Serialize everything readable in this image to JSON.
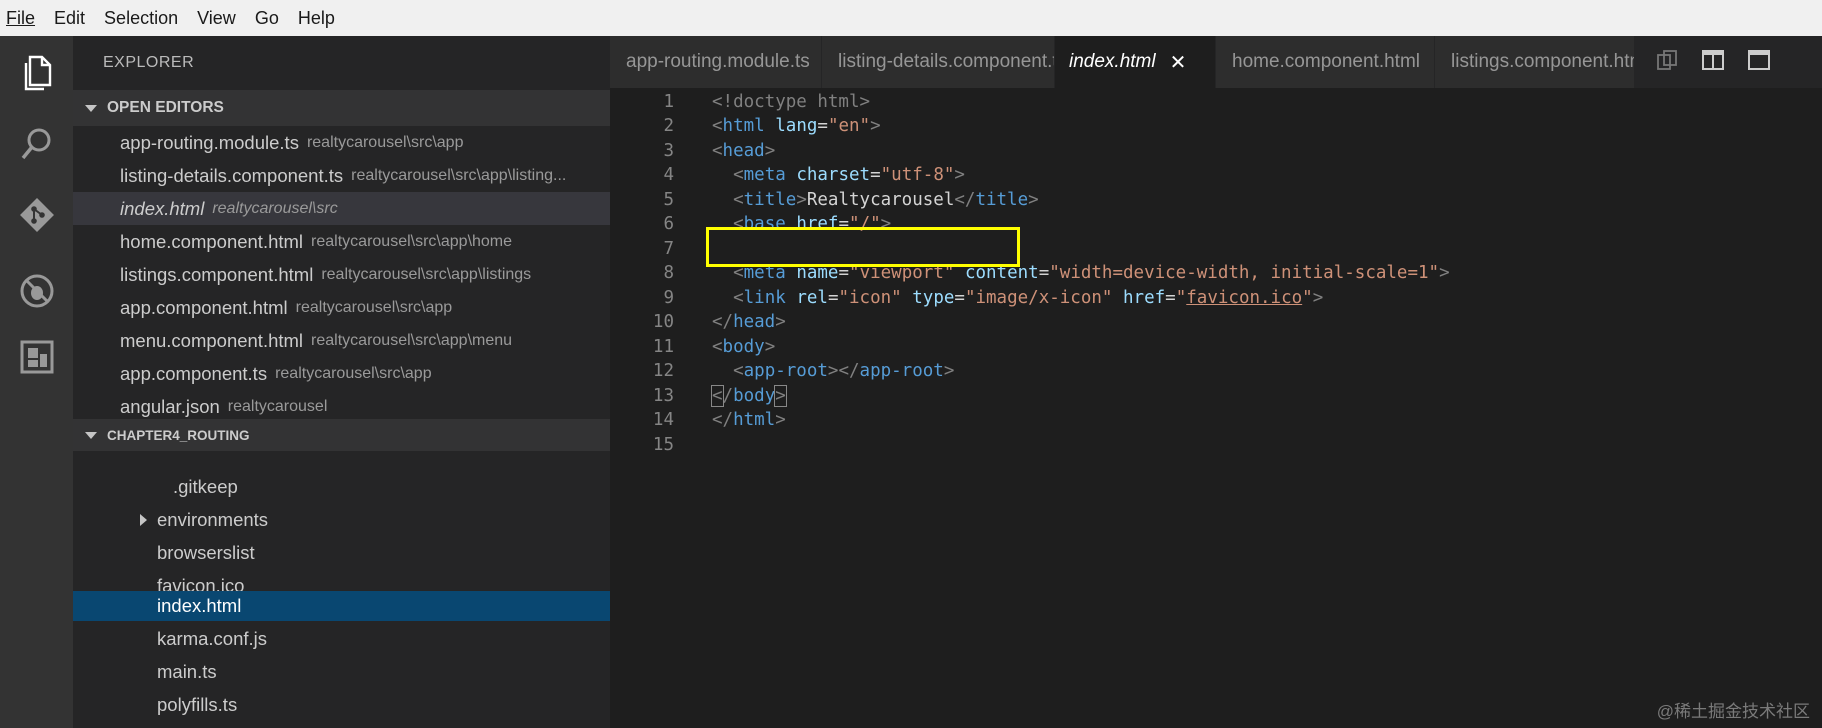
{
  "menu": [
    "File",
    "Edit",
    "Selection",
    "View",
    "Go",
    "Help"
  ],
  "activity": [
    "files-icon",
    "search-icon",
    "source-control-icon",
    "debug-icon",
    "extensions-icon"
  ],
  "explorer": {
    "title": "EXPLORER",
    "open_editors_header": "OPEN EDITORS",
    "open_editors": [
      {
        "name": "app-routing.module.ts",
        "path": "realtycarousel\\src\\app"
      },
      {
        "name": "listing-details.component.ts",
        "path": "realtycarousel\\src\\app\\listing..."
      },
      {
        "name": "index.html",
        "path": "realtycarousel\\src"
      },
      {
        "name": "home.component.html",
        "path": "realtycarousel\\src\\app\\home"
      },
      {
        "name": "listings.component.html",
        "path": "realtycarousel\\src\\app\\listings"
      },
      {
        "name": "app.component.html",
        "path": "realtycarousel\\src\\app"
      },
      {
        "name": "menu.component.html",
        "path": "realtycarousel\\src\\app\\menu"
      },
      {
        "name": "app.component.ts",
        "path": "realtycarousel\\src\\app"
      },
      {
        "name": "angular.json",
        "path": "realtycarousel"
      }
    ],
    "project_header": "CHAPTER4_ROUTING",
    "tree": [
      ".gitkeep",
      "environments",
      "browserslist",
      "favicon.ico",
      "index.html",
      "karma.conf.js",
      "main.ts",
      "polyfills.ts"
    ]
  },
  "tabs": [
    {
      "label": "app-routing.module.ts"
    },
    {
      "label": "listing-details.component.ts"
    },
    {
      "label": "index.html",
      "close": "✕"
    },
    {
      "label": "home.component.html"
    },
    {
      "label": "listings.component.html"
    }
  ],
  "editor": {
    "line_numbers": [
      "1",
      "2",
      "3",
      "4",
      "5",
      "6",
      "7",
      "8",
      "9",
      "10",
      "11",
      "12",
      "13",
      "14",
      "15"
    ],
    "strings": {
      "doctype": "<!doctype html>",
      "lang_val": "\"en\"",
      "charset_val": "\"utf-8\"",
      "title_text": "Realtycarousel",
      "base_href": "\"/\"",
      "vp_name": "\"viewport\"",
      "vp_content": "\"width=device-width, initial-scale=1\"",
      "icon_rel": "\"icon\"",
      "icon_type": "\"image/x-icon\"",
      "icon_href": "favicon.ico"
    }
  },
  "watermark": "@稀土掘金技术社区"
}
